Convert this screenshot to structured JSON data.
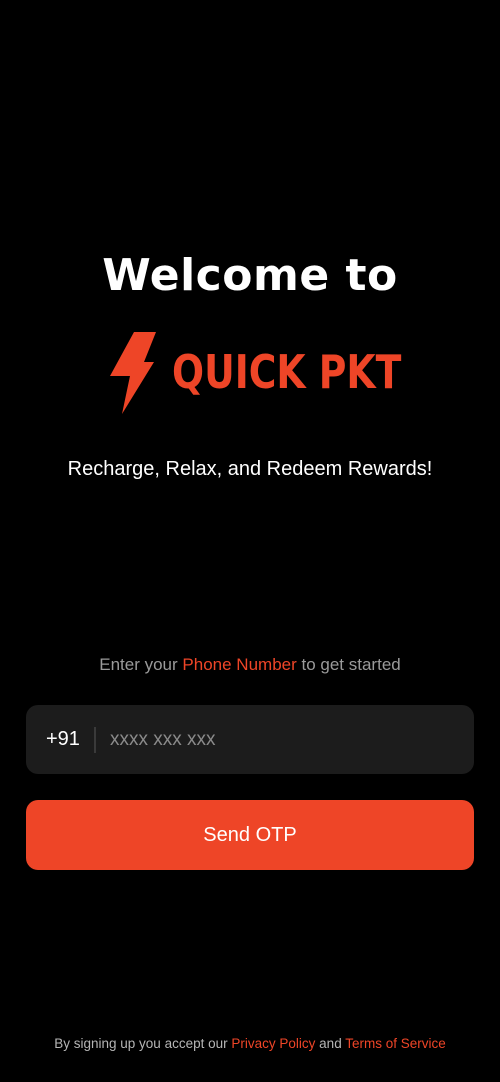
{
  "welcome": {
    "title": "Welcome to"
  },
  "logo": {
    "text": "QUICK PKT",
    "icon": "lightning-bolt-icon",
    "color": "#ee4527"
  },
  "tagline": "Recharge, Relax, and Redeem Rewards!",
  "prompt": {
    "before": "Enter your",
    "highlight": "Phone Number",
    "after": "to get started"
  },
  "phone": {
    "country_code": "+91",
    "placeholder": "xxxx xxx xxx",
    "value": ""
  },
  "send_button": {
    "label": "Send OTP",
    "color": "#ee4527"
  },
  "footer": {
    "before": "By signing up you accept our",
    "privacy_link": "Privacy Policy",
    "conjunction": "and",
    "terms_link": "Terms of Service"
  },
  "colors": {
    "background": "#000000",
    "accent": "#ee4527",
    "input_background": "#1c1c1c"
  }
}
